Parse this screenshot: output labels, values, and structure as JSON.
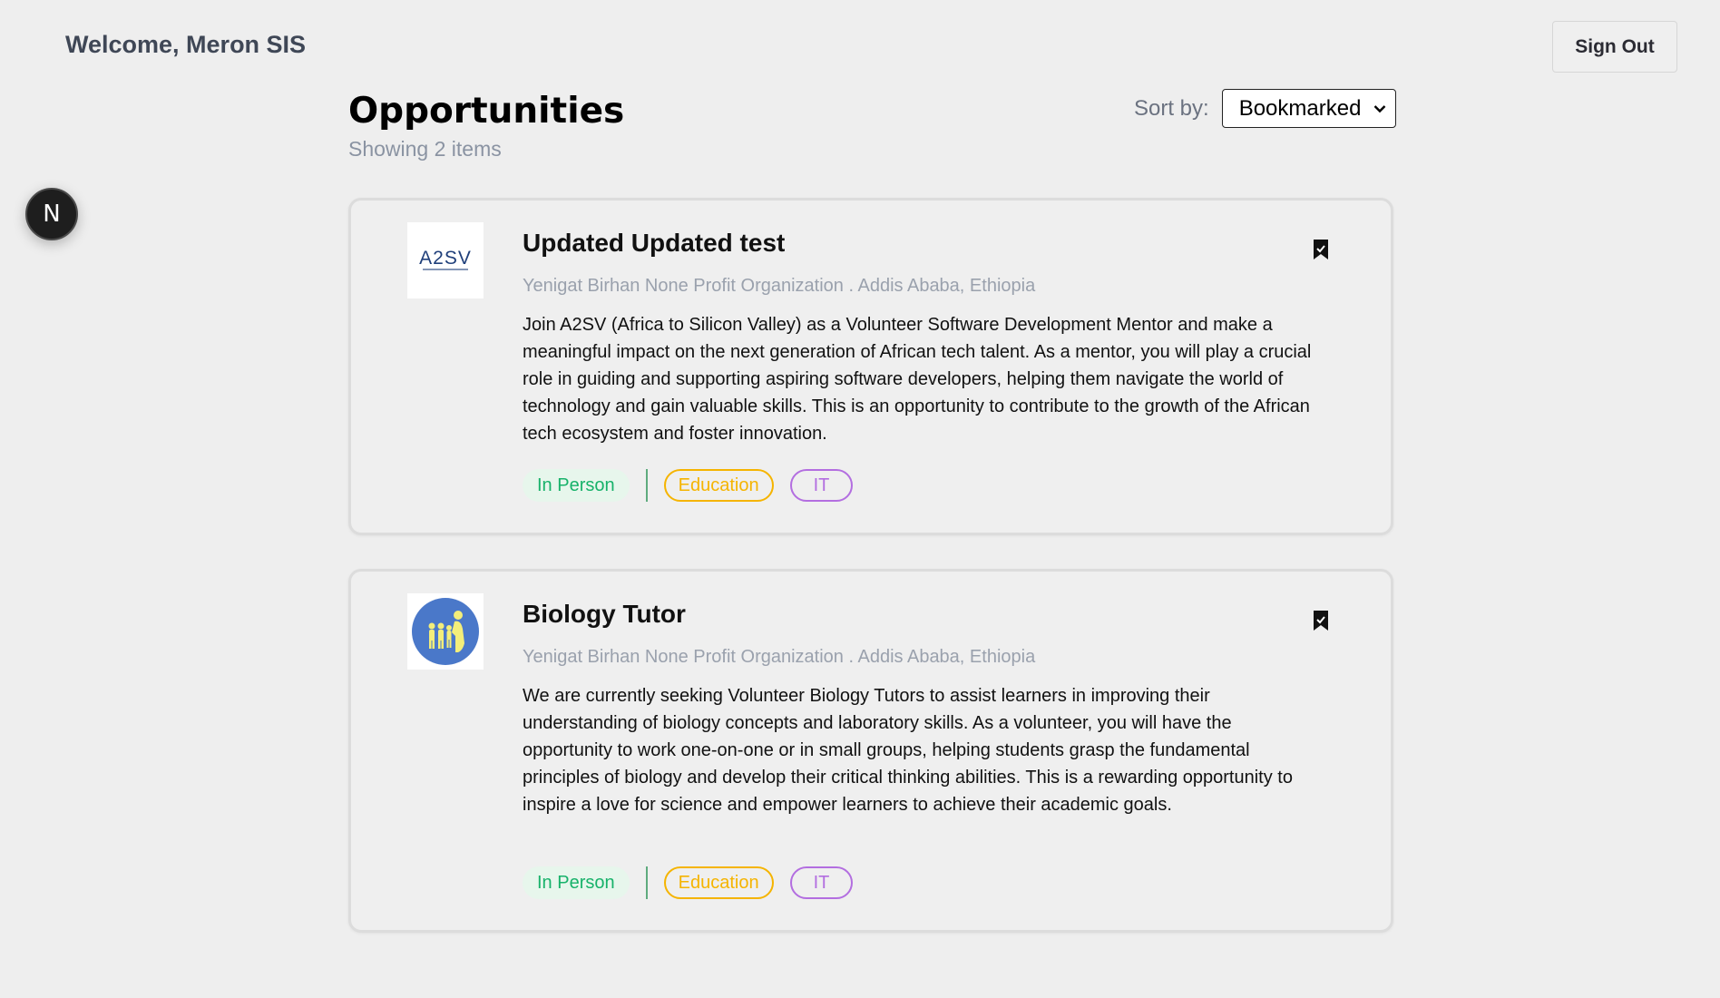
{
  "header": {
    "welcome": "Welcome, Meron SIS",
    "sign_out": "Sign Out"
  },
  "badge": {
    "letter": "N"
  },
  "main": {
    "title": "Opportunities",
    "showing": "Showing 2 items",
    "sort_label": "Sort by:",
    "sort_value": "Bookmarked"
  },
  "opportunities": [
    {
      "title": "Updated Updated test",
      "org": "Yenigat Birhan None Profit Organization . Addis Ababa, Ethiopia",
      "logo_text": "A2SV",
      "description": "Join A2SV (Africa to Silicon Valley) as a Volunteer Software Development Mentor and make a meaningful impact on the next generation of African tech talent. As a mentor, you will play a crucial role in guiding and supporting aspiring software developers, helping them navigate the world of technology and gain valuable skills. This is an opportunity to contribute to the growth of the African tech ecosystem and foster innovation.",
      "tags": [
        "In Person",
        "Education",
        "IT"
      ],
      "bookmarked": true
    },
    {
      "title": "Biology Tutor",
      "org": "Yenigat Birhan None Profit Organization . Addis Ababa, Ethiopia",
      "logo_text": "",
      "description": "We are currently seeking Volunteer Biology Tutors to assist learners in improving their understanding of biology concepts and laboratory skills. As a volunteer, you will have the opportunity to work one-on-one or in small groups, helping students grasp the fundamental principles of biology and develop their critical thinking abilities. This is a rewarding opportunity to inspire a love for science and empower learners to achieve their academic goals.",
      "tags": [
        "In Person",
        "Education",
        "IT"
      ],
      "bookmarked": true
    }
  ],
  "colors": {
    "background": "#eeeeee",
    "tag_green": "#17b26a",
    "tag_yellow": "#f5b400",
    "tag_purple": "#b36ee0",
    "logo_blue": "#4a78c9"
  },
  "icons": {
    "bookmark": "bookmark-filled-icon",
    "dropdown": "chevron-down-icon"
  }
}
